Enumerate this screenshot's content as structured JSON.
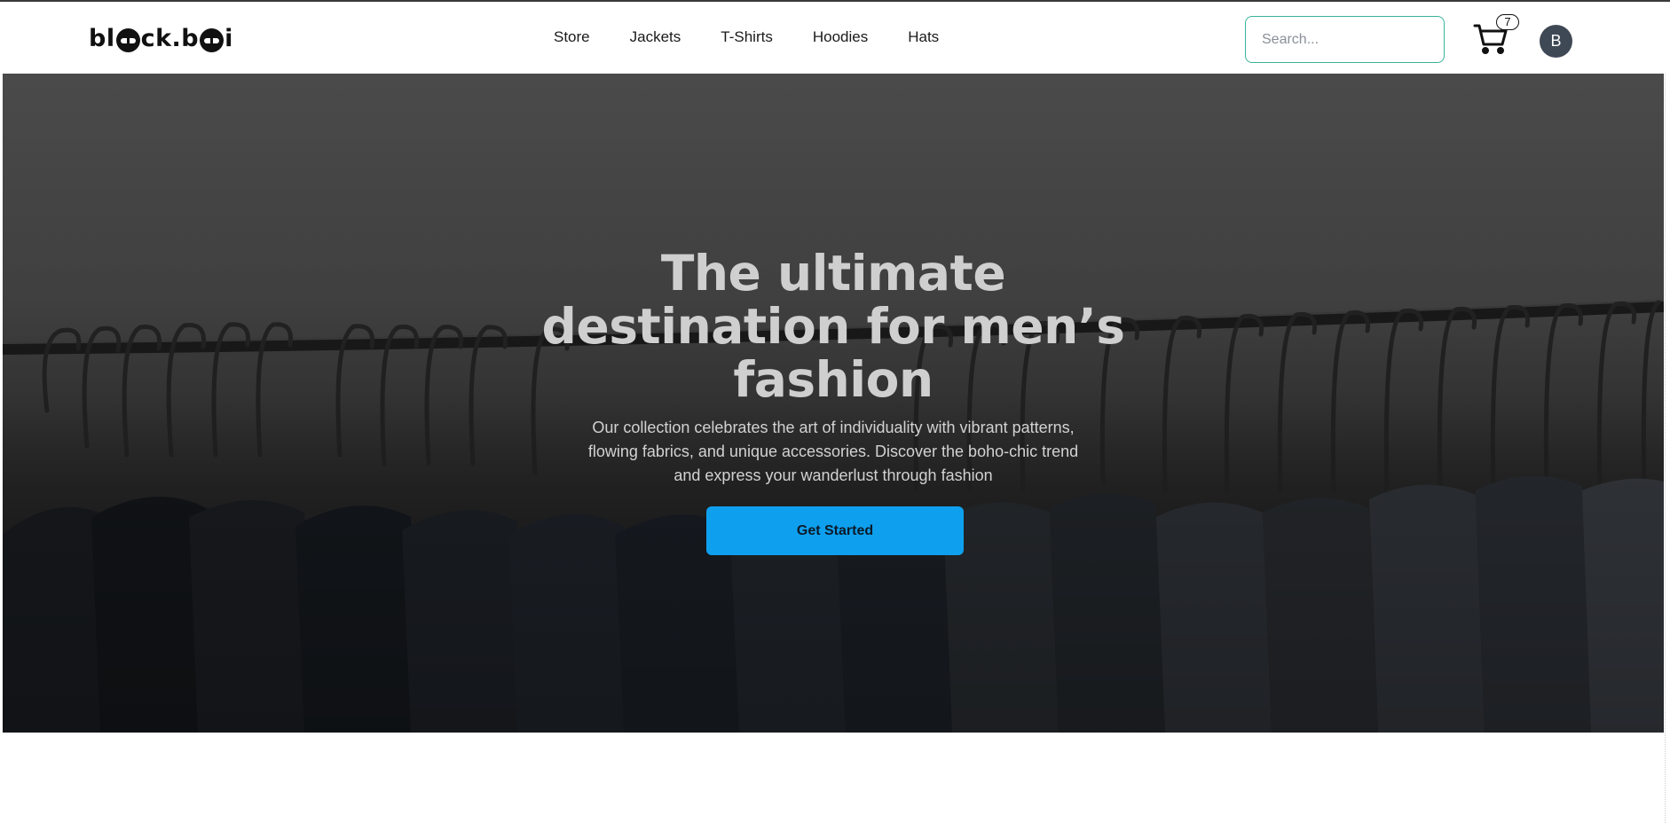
{
  "brand": {
    "logo_text_left": "bl",
    "logo_text_mid": "ck.b",
    "logo_text_right": "i"
  },
  "nav": {
    "links": [
      "Store",
      "Jackets",
      "T-Shirts",
      "Hoodies",
      "Hats"
    ]
  },
  "search": {
    "placeholder": "Search..."
  },
  "cart": {
    "count": "7"
  },
  "user": {
    "initial": "B"
  },
  "hero": {
    "title": "The ultimate destination for men’s fashion",
    "description": "Our collection celebrates the art of individuality with vibrant patterns, flowing fabrics, and unique accessories. Discover the boho-chic trend and express your wanderlust through fashion",
    "cta_label": "Get Started"
  },
  "colors": {
    "accent": "#3bb39a",
    "cta": "#0ea0ee",
    "avatar": "#3f4855"
  }
}
